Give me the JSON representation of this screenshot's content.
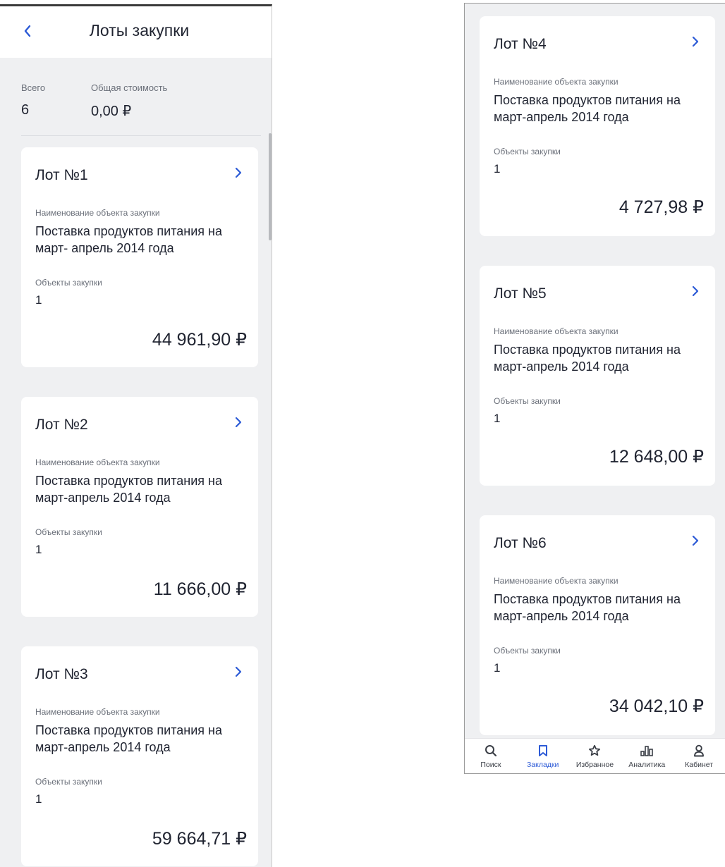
{
  "header": {
    "title": "Лоты закупки"
  },
  "summary": {
    "total_label": "Всего",
    "total_value": "6",
    "cost_label": "Общая стоимость",
    "cost_value": "0,00 ₽"
  },
  "lots": [
    {
      "title": "Лот №1",
      "name_label": "Наименование объекта закупки",
      "name": "Поставка продуктов питания на март- апрель 2014 года",
      "objects_label": "Объекты закупки",
      "objects": "1",
      "price": "44 961,90 ₽"
    },
    {
      "title": "Лот №2",
      "name_label": "Наименование объекта закупки",
      "name": "Поставка продуктов питания на март-апрель 2014 года",
      "objects_label": "Объекты закупки",
      "objects": "1",
      "price": "11 666,00 ₽"
    },
    {
      "title": "Лот №3",
      "name_label": "Наименование объекта закупки",
      "name": "Поставка продуктов питания на март-апрель 2014 года",
      "objects_label": "Объекты закупки",
      "objects": "1",
      "price": "59 664,71 ₽"
    },
    {
      "title": "Лот №4",
      "name_label": "Наименование объекта закупки",
      "name": "Поставка продуктов питания на март-апрель 2014 года",
      "objects_label": "Объекты закупки",
      "objects": "1",
      "price": "4 727,98 ₽"
    },
    {
      "title": "Лот №5",
      "name_label": "Наименование объекта закупки",
      "name": "Поставка продуктов питания на март-апрель 2014 года",
      "objects_label": "Объекты закупки",
      "objects": "1",
      "price": "12 648,00 ₽"
    },
    {
      "title": "Лот №6",
      "name_label": "Наименование объекта закупки",
      "name": "Поставка продуктов питания на март-апрель 2014 года",
      "objects_label": "Объекты закупки",
      "objects": "1",
      "price": "34 042,10 ₽"
    }
  ],
  "nav": [
    {
      "label": "Поиск",
      "icon": "search-icon",
      "active": false
    },
    {
      "label": "Закладки",
      "icon": "bookmark-icon",
      "active": true
    },
    {
      "label": "Избранное",
      "icon": "star-icon",
      "active": false
    },
    {
      "label": "Аналитика",
      "icon": "analytics-icon",
      "active": false
    },
    {
      "label": "Кабинет",
      "icon": "user-icon",
      "active": false
    }
  ],
  "colors": {
    "accent": "#2c5ad6",
    "background": "#eff0f2",
    "card": "#ffffff",
    "text": "#1f2330",
    "muted": "#6b707a"
  }
}
